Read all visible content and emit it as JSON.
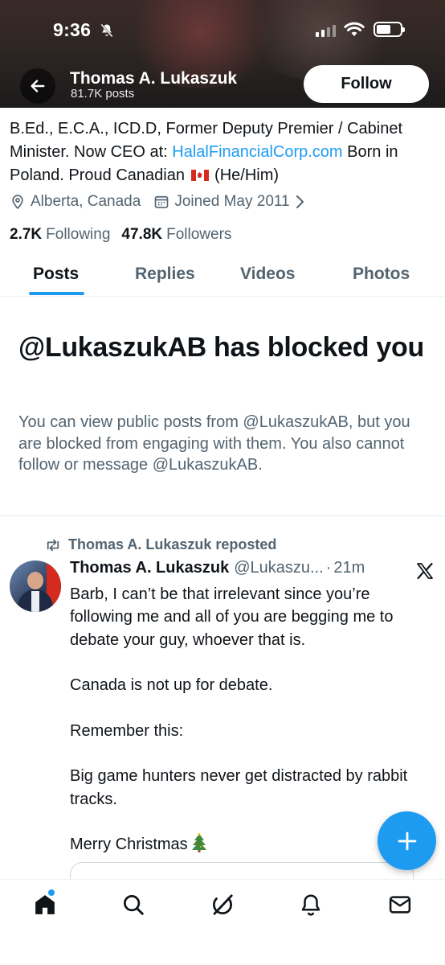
{
  "status_bar": {
    "time": "9:36"
  },
  "header": {
    "name": "Thomas A. Lukaszuk",
    "posts_count": "81.7K posts",
    "follow_label": "Follow"
  },
  "bio": {
    "text_before_link": "B.Ed., E.C.A., ICD.D, Former Deputy Premier / Cabinet Minister. Now CEO at: ",
    "link": "HalalFinancialCorp.com",
    "text_after_link": " Born in Poland. Proud Canadian ",
    "text_after_flag": " (He/Him)"
  },
  "meta": {
    "location": "Alberta, Canada",
    "joined": "Joined May 2011"
  },
  "counts": {
    "following_value": "2.7K",
    "following_label": "Following",
    "followers_value": "47.8K",
    "followers_label": "Followers"
  },
  "tabs": [
    {
      "label": "Posts",
      "active": true
    },
    {
      "label": "Replies",
      "active": false
    },
    {
      "label": "Videos",
      "active": false
    },
    {
      "label": "Photos",
      "active": false
    }
  ],
  "blocked": {
    "title": "@LukaszukAB has blocked you",
    "description": "You can view public posts from @LukaszukAB, but you are blocked from engaging with them. You also cannot follow or message @LukaszukAB."
  },
  "post": {
    "repost_label": "Thomas A. Lukaszuk reposted",
    "author_name": "Thomas A. Lukaszuk",
    "author_handle": "@Lukaszu...",
    "separator": "·",
    "time": "21m",
    "paragraphs": [
      "Barb, I can’t be that irrelevant since you’re following me and all of you are begging me to debate your guy, whoever that is.",
      "Canada is not up for debate.",
      "Remember this:",
      "Big game hunters never get distracted by rabbit tracks.",
      "Merry Christmas"
    ]
  },
  "icons": {
    "accent": "#1d9bf0",
    "text_primary": "#0f1419",
    "text_secondary": "#536471"
  }
}
